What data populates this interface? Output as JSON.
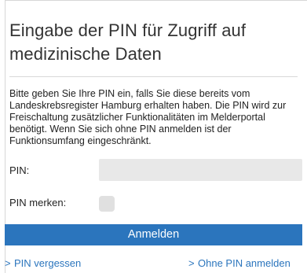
{
  "dialog": {
    "title": "Eingabe der PIN für Zugriff auf medizinische Daten",
    "description": "Bitte geben Sie Ihre PIN ein, falls Sie diese bereits vom Landeskrebsregister Hamburg erhalten haben. Die PIN wird zur Freischaltung zusätzlicher Funktionalitäten im Melderportal benötigt. Wenn Sie sich ohne PIN anmelden ist der Funktionsumfang eingeschränkt."
  },
  "form": {
    "pin_label": "PIN:",
    "pin_value": "",
    "pin_placeholder": "",
    "remember_label": "PIN merken:",
    "remember_checked": false,
    "submit_label": "Anmelden"
  },
  "links": {
    "chevron": ">",
    "forgot_label": "PIN vergessen",
    "nopin_label": "Ohne PIN anmelden"
  },
  "colors": {
    "accent": "#2b75bd",
    "input_background": "#e8e8e8"
  }
}
